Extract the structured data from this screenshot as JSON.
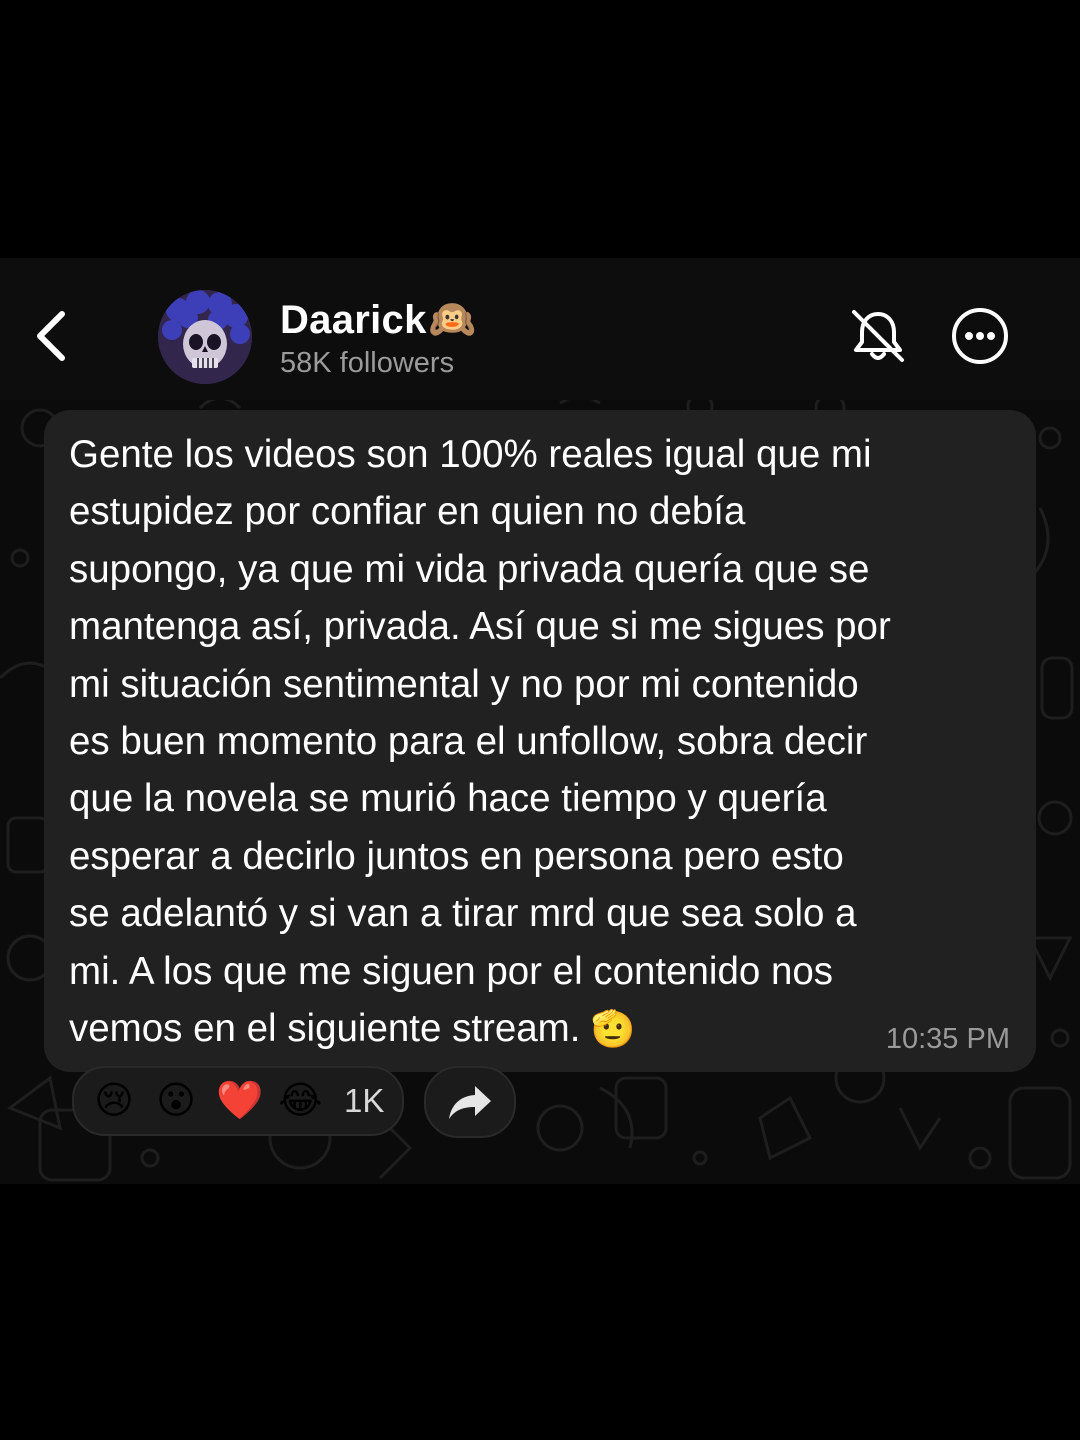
{
  "header": {
    "channel_name": "Daarick",
    "channel_emoji": "🙉",
    "followers": "58K followers",
    "back_icon": "chevron-left-icon",
    "mute_icon": "bell-slash-icon",
    "more_icon": "ellipsis-circle-icon"
  },
  "message": {
    "lines": [
      "Gente los videos son 100% reales igual que mi",
      "estupidez por confiar en quien no debía",
      "supongo, ya que mi vida privada quería que se",
      "mantenga así, privada. Así que si me sigues por",
      "mi situación sentimental y no por mi contenido",
      "es buen momento para el unfollow, sobra decir",
      "que la novela se murió hace tiempo y quería",
      "esperar a decirlo juntos en persona pero esto",
      "se adelantó y si van a tirar mrd que sea solo a",
      "mi. A los que me siguen por el contenido nos",
      "vemos en el siguiente stream."
    ],
    "trailing_emoji": "🫡",
    "time": "10:35 PM"
  },
  "reactions": {
    "emojis": [
      "😢",
      "😮",
      "❤️",
      "😂"
    ],
    "count": "1K",
    "forward_icon": "share-arrow-icon"
  },
  "colors": {
    "background": "#000000",
    "chat_background": "#0b0b0b",
    "bubble": "#212121",
    "text": "#ffffff",
    "muted_text": "#9b9b9b"
  }
}
